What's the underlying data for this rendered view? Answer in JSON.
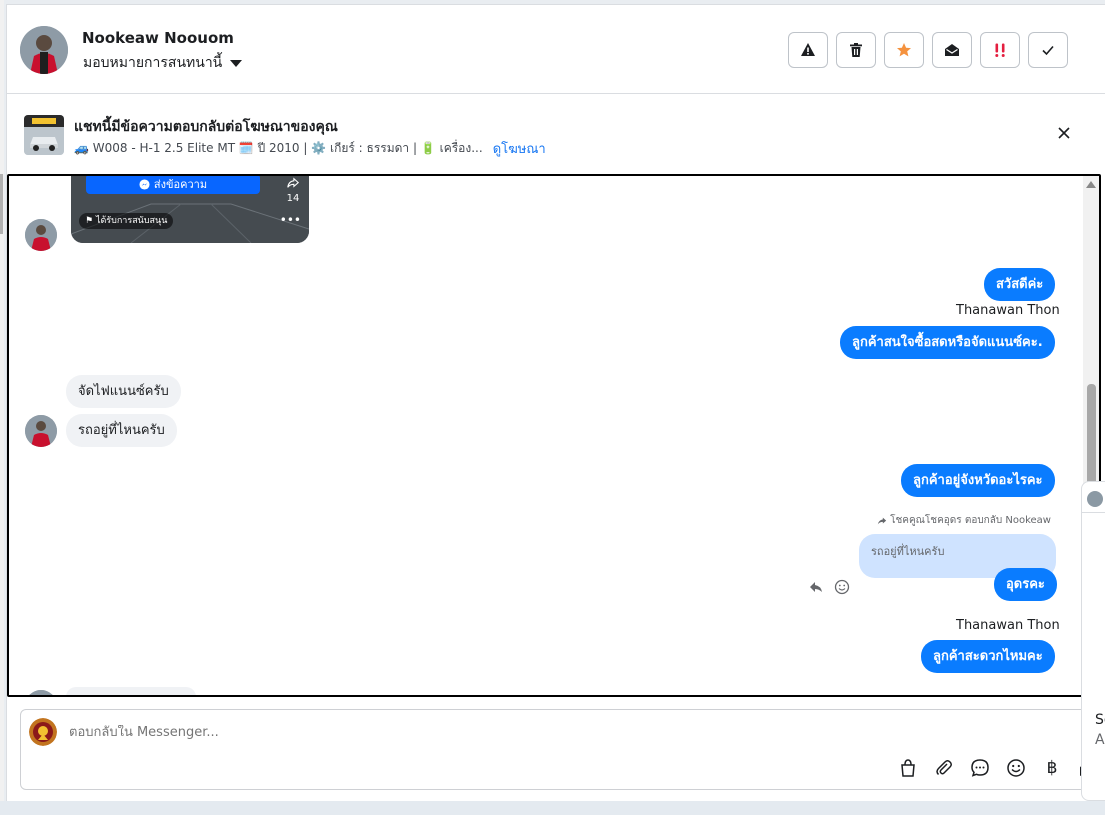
{
  "header": {
    "user_name": "Nookeaw Noouom",
    "assign_label": "มอบหมายการสนทนานี้",
    "actions": [
      "warning-icon",
      "trash-icon",
      "star-icon",
      "envelope-open-icon",
      "double-exclamation-icon",
      "check-icon"
    ]
  },
  "ad_banner": {
    "title": "แชทนี้มีข้อความตอบกลับต่อโฆษณาของคุณ",
    "meta": "🚙 W008 - H-1 2.5 Elite MT 🗓️ ปี 2010 | ⚙️ เกียร์ : ธรรมดา | 🔋 เครื่อง...",
    "link": "ดูโฆษณา"
  },
  "thread": {
    "ad_card": {
      "button": "ส่งข้อความ",
      "badge": "ได้รับการสนับสนุน",
      "shares": "14"
    },
    "messages": [
      {
        "dir": "out",
        "text": "สวัสดีค่ะ"
      },
      {
        "sender": "Thanawan Thon"
      },
      {
        "dir": "out",
        "text": "ลูกค้าสนใจซื้อสดหรือจัดแนนซ์คะ."
      },
      {
        "dir": "in",
        "text": "จัดไฟแนนซ์ครับ"
      },
      {
        "dir": "in",
        "text": "รถอยู่ที่ไหนครับ"
      },
      {
        "dir": "out",
        "text": "ลูกค้าอยู่จังหวัดอะไรคะ"
      },
      {
        "reply_note": "โชคคูณโชคอุดร ตอบกลับ Nookeaw"
      },
      {
        "quoted": "รถอยู่ที่ไหนครับ"
      },
      {
        "dir": "out",
        "text": "อุดรคะ"
      },
      {
        "sender": "Thanawan Thon"
      },
      {
        "dir": "out",
        "text": "ลูกค้าสะดวกไหมคะ"
      }
    ]
  },
  "composer": {
    "placeholder": "ตอบกลับใน Messenger...",
    "tools": [
      "bag-icon",
      "paperclip-icon",
      "chat-bubble-icon",
      "emoji-icon",
      "baht-icon",
      "thumbs-up-icon"
    ],
    "baht_symbol": "฿"
  },
  "side_peek": {
    "text1": "So",
    "text2": "A"
  }
}
